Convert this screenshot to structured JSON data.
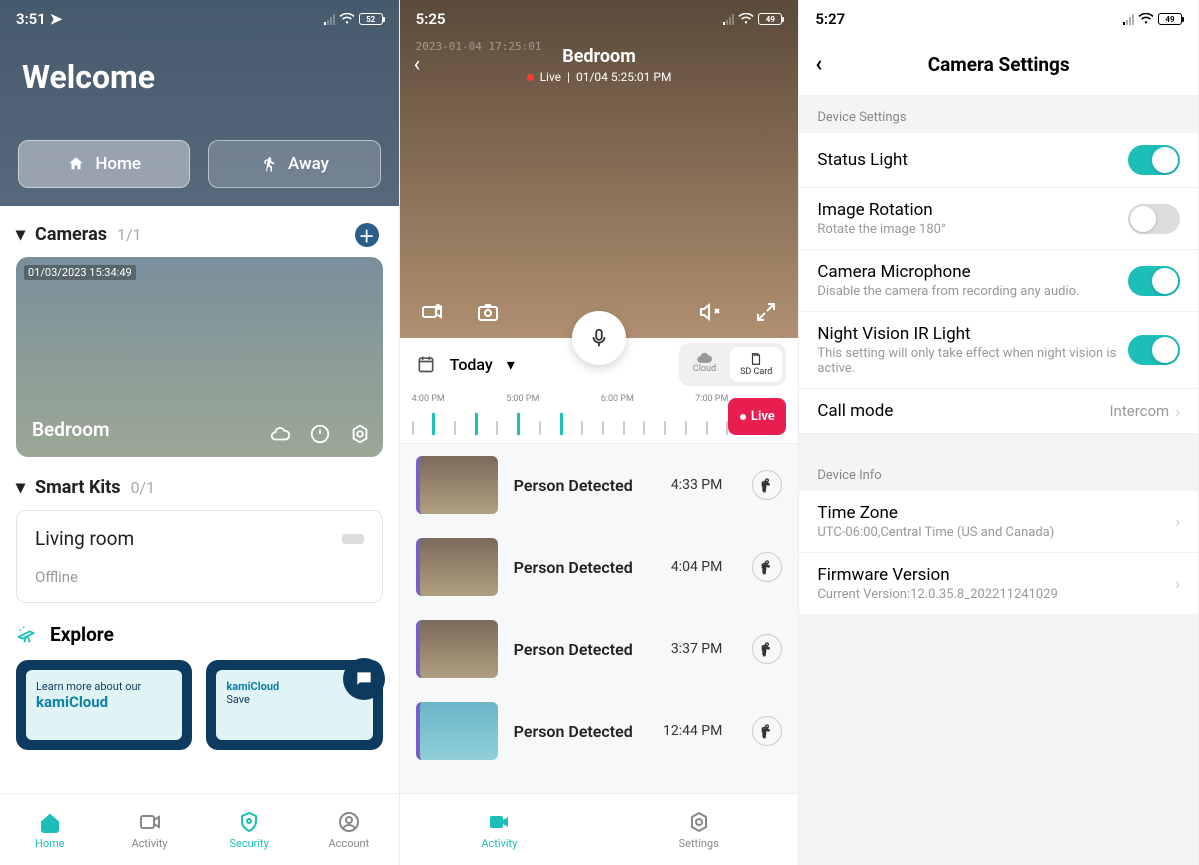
{
  "screen1": {
    "status": {
      "time": "3:51",
      "battery": "52"
    },
    "welcome": "Welcome",
    "modes": {
      "home": "Home",
      "away": "Away"
    },
    "cameras": {
      "label": "Cameras",
      "count": "1/1"
    },
    "camera": {
      "timestamp": "01/03/2023 15:34:49",
      "name": "Bedroom"
    },
    "smartkits": {
      "label": "Smart Kits",
      "count": "0/1"
    },
    "kit": {
      "name": "Living room",
      "status": "Offline"
    },
    "explore": {
      "label": "Explore",
      "card1_line1": "Learn more about our",
      "card1_line2": "kamiCloud",
      "card2_line1": "kamiCloud",
      "card2_line2": "Save"
    },
    "tabs": {
      "home": "Home",
      "activity": "Activity",
      "security": "Security",
      "account": "Account"
    }
  },
  "screen2": {
    "status": {
      "time": "5:25",
      "battery": "49"
    },
    "overlay_ts": "2023-01-04 17:25:01",
    "title": "Bedroom",
    "live_label": "Live",
    "live_ts": "01/04 5:25:01 PM",
    "date": {
      "today": "Today"
    },
    "storage": {
      "cloud": "Cloud",
      "sd": "SD Card"
    },
    "timeline": {
      "labels": [
        "4:00 PM",
        "5:00 PM",
        "6:00 PM",
        "7:00 PM"
      ]
    },
    "live_pill": "Live",
    "events": [
      {
        "label": "Person Detected",
        "time": "4:33 PM"
      },
      {
        "label": "Person Detected",
        "time": "4:04 PM"
      },
      {
        "label": "Person Detected",
        "time": "3:37 PM"
      },
      {
        "label": "Person Detected",
        "time": "12:44 PM"
      }
    ],
    "tabs": {
      "activity": "Activity",
      "settings": "Settings"
    }
  },
  "screen3": {
    "status": {
      "time": "5:27",
      "battery": "49"
    },
    "title": "Camera Settings",
    "section_device": "Device Settings",
    "rows": {
      "status_light": {
        "title": "Status Light",
        "on": true
      },
      "image_rotation": {
        "title": "Image Rotation",
        "sub": "Rotate the image 180°",
        "on": false
      },
      "microphone": {
        "title": "Camera Microphone",
        "sub": "Disable the camera from recording any audio.",
        "on": true
      },
      "night_vision": {
        "title": "Night Vision IR Light",
        "sub": "This setting will only take effect when night vision is active.",
        "on": true
      },
      "call_mode": {
        "title": "Call mode",
        "value": "Intercom"
      }
    },
    "section_info": "Device Info",
    "info": {
      "timezone": {
        "title": "Time Zone",
        "sub": "UTC-06:00,Central Time (US and Canada)"
      },
      "firmware": {
        "title": "Firmware Version",
        "sub": "Current Version:12.0.35.8_202211241029"
      }
    }
  }
}
